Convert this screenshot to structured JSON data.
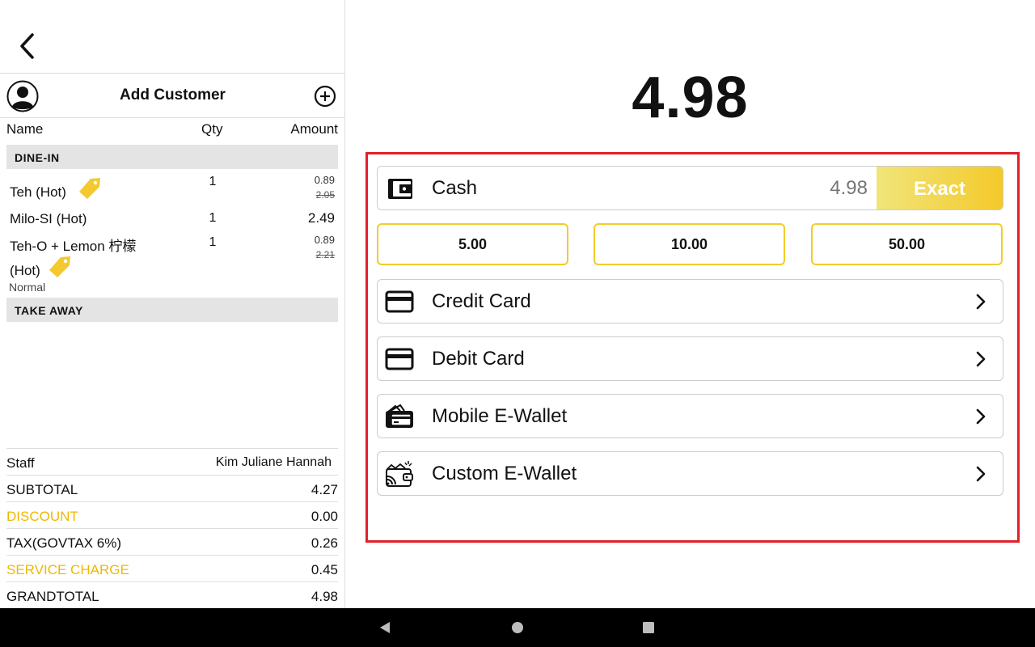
{
  "customer": {
    "add_label": "Add Customer"
  },
  "columns": {
    "name": "Name",
    "qty": "Qty",
    "amount": "Amount"
  },
  "sections": {
    "dine_in": "DINE-IN",
    "take_away": "TAKE AWAY"
  },
  "items": [
    {
      "name": "Teh (Hot)",
      "qty": "1",
      "price": "0.89",
      "original": "2.05"
    },
    {
      "name": "Milo-SI (Hot)",
      "qty": "1",
      "price": "2.49"
    },
    {
      "name_line1": "Teh-O + Lemon 柠檬",
      "name_line2": "(Hot)",
      "note": "Normal",
      "qty": "1",
      "price": "0.89",
      "original": "2.21"
    }
  ],
  "summary": {
    "staff_label": "Staff",
    "staff_value": "Kim Juliane Hannah",
    "subtotal_label": "SUBTOTAL",
    "subtotal_value": "4.27",
    "discount_label": "DISCOUNT",
    "discount_value": "0.00",
    "tax_label": "TAX(GOVTAX 6%)",
    "tax_value": "0.26",
    "service_label": "SERVICE CHARGE",
    "service_value": "0.45",
    "grand_label": "GRANDTOTAL",
    "grand_value": "4.98"
  },
  "payment": {
    "total": "4.98",
    "cash_label": "Cash",
    "cash_placeholder": "4.98",
    "exact_label": "Exact",
    "quick_amounts": [
      "5.00",
      "10.00",
      "50.00"
    ],
    "methods": [
      "Credit Card",
      "Debit Card",
      "Mobile E-Wallet",
      "Custom E-Wallet"
    ]
  },
  "colors": {
    "accent_yellow": "#f2cc2a",
    "highlight_red": "#e0202a"
  },
  "icons": [
    "back-arrow-icon",
    "user-avatar-icon",
    "add-circle-icon",
    "tag-icon",
    "wallet-icon",
    "card-icon",
    "e-wallet-icon",
    "custom-wallet-icon",
    "chevron-right-icon"
  ]
}
